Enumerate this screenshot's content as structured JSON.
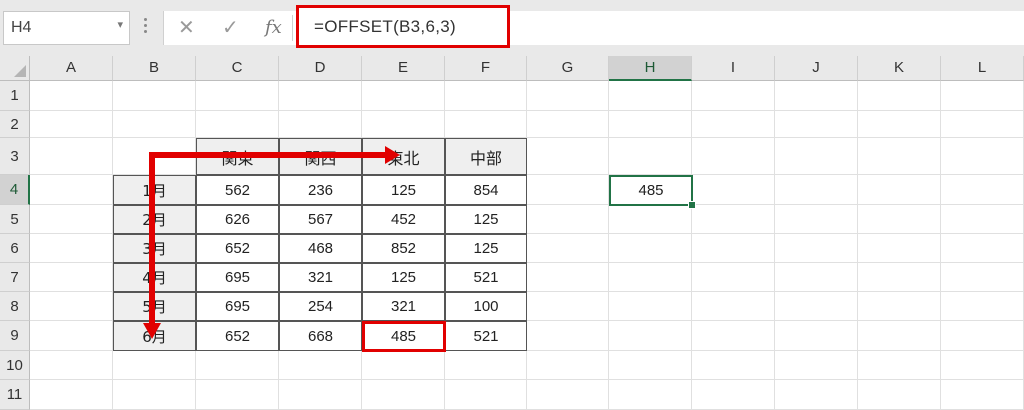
{
  "formula_bar": {
    "name_box": "H4",
    "name_box_arrow": "▾",
    "cancel_icon": "✕",
    "enter_icon": "✓",
    "fx_label": "fx",
    "formula": "=OFFSET(B3,6,3)"
  },
  "columns": [
    "A",
    "B",
    "C",
    "D",
    "E",
    "F",
    "G",
    "H",
    "I",
    "J",
    "K",
    "L"
  ],
  "rows": [
    "1",
    "2",
    "3",
    "4",
    "5",
    "6",
    "7",
    "8",
    "9",
    "10",
    "11"
  ],
  "selected_cell": {
    "column": "H",
    "row": "4",
    "value": "485"
  },
  "table": {
    "headers": [
      "関東",
      "関西",
      "東北",
      "中部"
    ],
    "rows": [
      {
        "label": "1月",
        "values": [
          "562",
          "236",
          "125",
          "854"
        ]
      },
      {
        "label": "2月",
        "values": [
          "626",
          "567",
          "452",
          "125"
        ]
      },
      {
        "label": "3月",
        "values": [
          "652",
          "468",
          "852",
          "125"
        ]
      },
      {
        "label": "4月",
        "values": [
          "695",
          "321",
          "125",
          "521"
        ]
      },
      {
        "label": "5月",
        "values": [
          "695",
          "254",
          "321",
          "100"
        ]
      },
      {
        "label": "6月",
        "values": [
          "652",
          "668",
          "485",
          "521"
        ]
      }
    ]
  },
  "annotation": {
    "arrow_color": "#e10000",
    "highlight_color": "#e10000"
  },
  "accent_color": "#217346"
}
